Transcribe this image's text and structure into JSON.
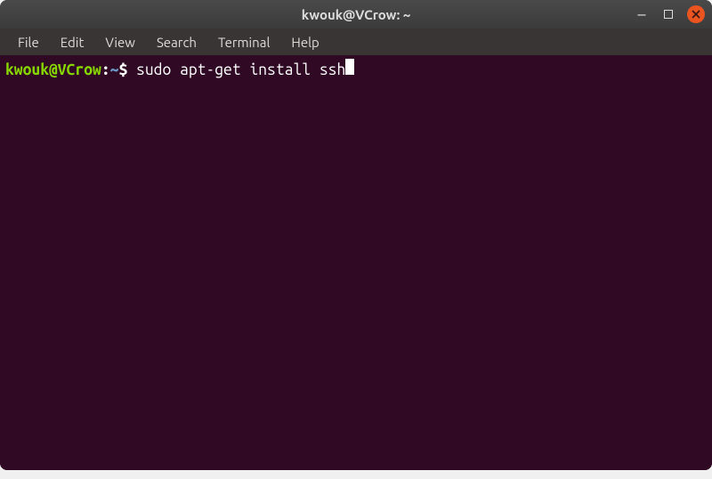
{
  "window": {
    "title": "kwouk@VCrow: ~"
  },
  "menubar": {
    "items": [
      "File",
      "Edit",
      "View",
      "Search",
      "Terminal",
      "Help"
    ]
  },
  "terminal": {
    "prompt": {
      "userhost": "kwouk@VCrow",
      "colon": ":",
      "path": "~",
      "symbol": "$"
    },
    "command": " sudo apt-get install ssh"
  },
  "icons": {
    "minimize": "–",
    "close_label": "close"
  }
}
